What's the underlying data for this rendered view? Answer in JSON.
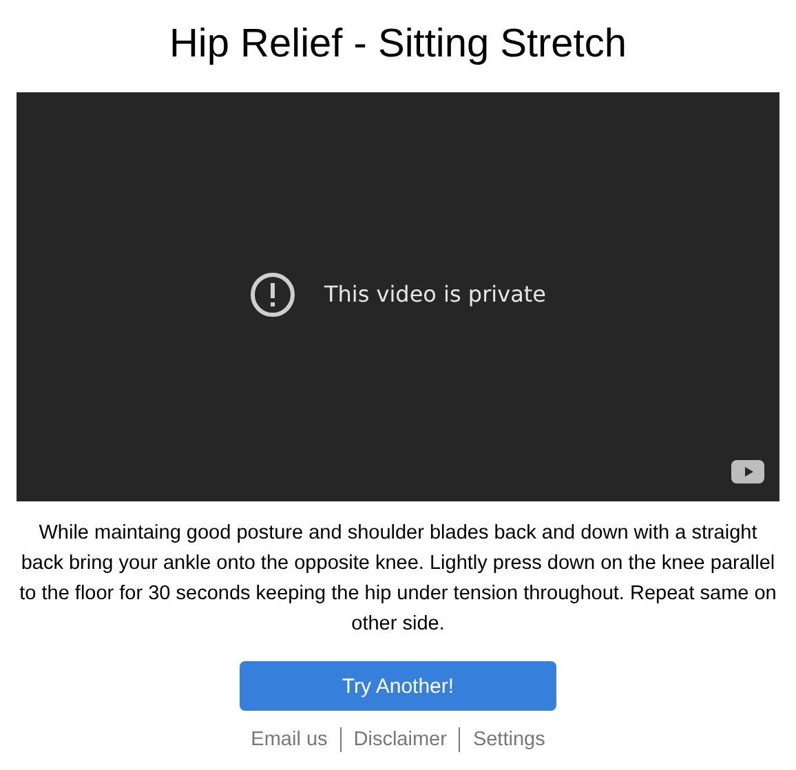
{
  "title": "Hip Relief - Sitting Stretch",
  "video": {
    "message": "This video is private"
  },
  "description": "While maintaing good posture and shoulder blades back and down with a straight back bring your ankle onto the opposite knee. Lightly press down on the knee parallel to the floor for 30 seconds keeping the hip under tension throughout. Repeat same on other side.",
  "button": "Try Another!",
  "footer_links": [
    "Email us",
    "Disclaimer",
    "Settings"
  ]
}
